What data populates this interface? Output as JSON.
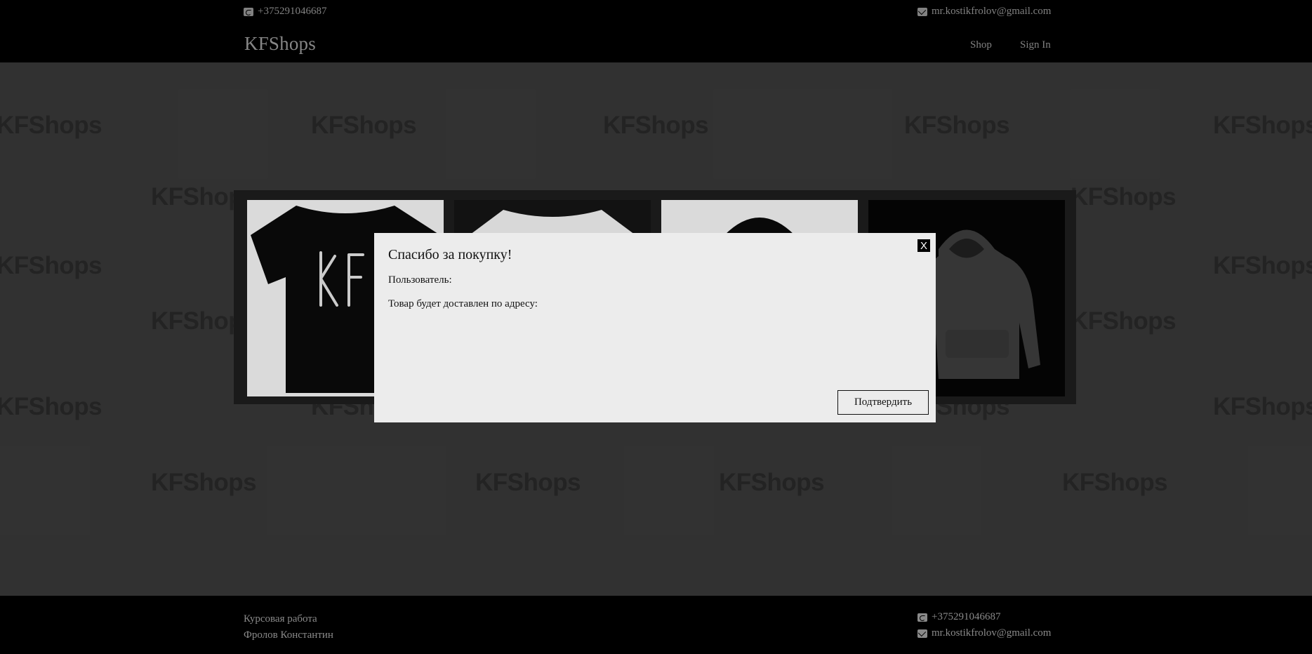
{
  "topbar": {
    "phone": "+375291046687",
    "email": "mr.kostikfrolov@gmail.com",
    "phone_icon": "phone-icon",
    "email_icon": "mail-icon"
  },
  "navbar": {
    "brand": "KFShops",
    "links": [
      {
        "label": "Shop"
      },
      {
        "label": "Sign In"
      }
    ]
  },
  "watermark": {
    "text": "KFShops"
  },
  "modal": {
    "title": "Спасибо за покупку!",
    "user_label": "Пользователь:",
    "address_label": "Товар будет доставлен по адресу:",
    "close_label": "X",
    "confirm_label": "Подтвердить"
  },
  "footer": {
    "line1": "Курсовая работа",
    "line2": "Фролов Константин",
    "phone": "+375291046687",
    "email": "mr.kostikfrolov@gmail.com"
  },
  "colors": {
    "background": "#353535",
    "bar": "#000000",
    "modal": "#ececec",
    "text_muted": "#8a8a8a"
  }
}
